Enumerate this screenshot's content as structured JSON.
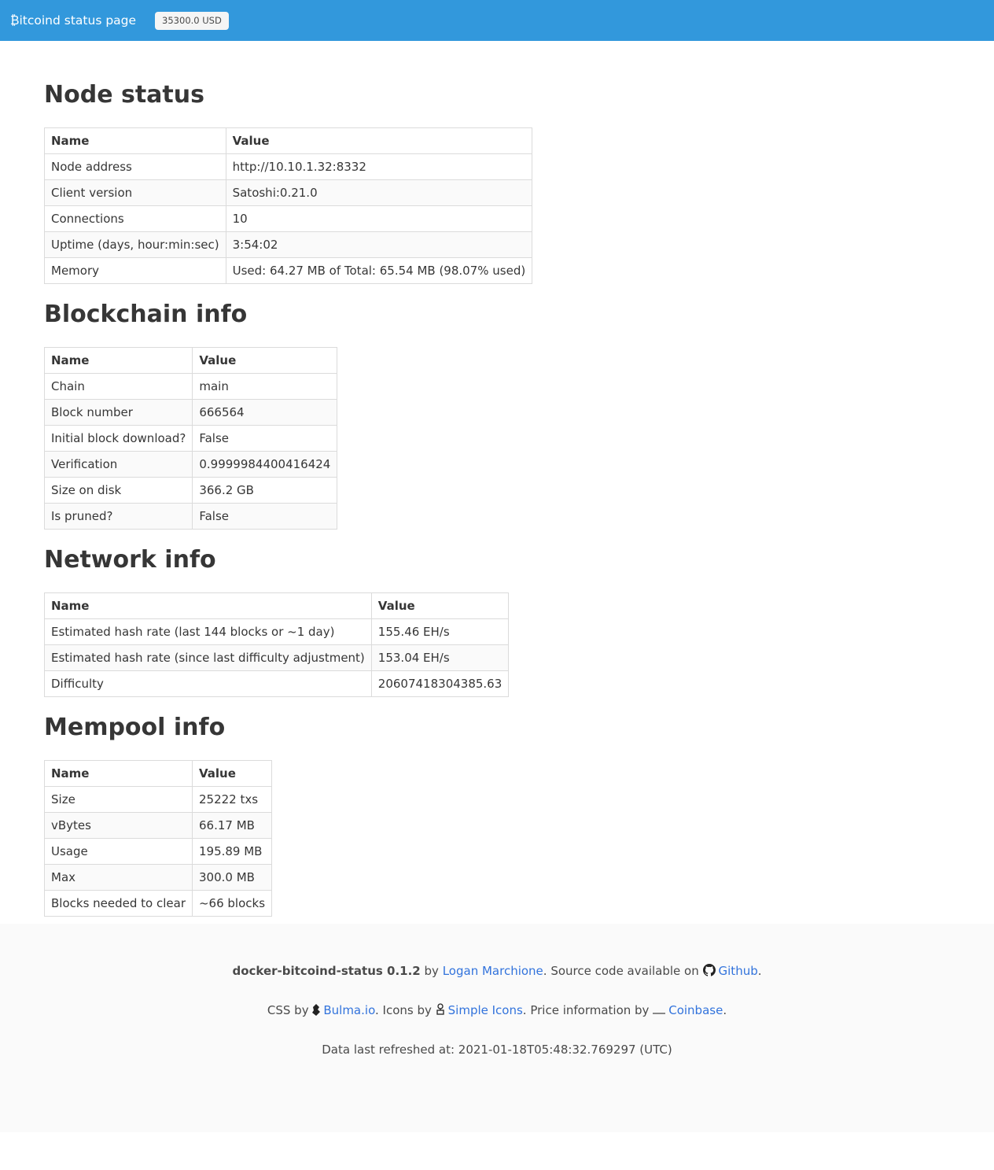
{
  "navbar": {
    "brand_symbol": "₿",
    "brand_label": "itcoind status page",
    "price": "35300.0 USD",
    "color": "#3298dc"
  },
  "sections": {
    "node": {
      "title": "Node status",
      "headers": [
        "Name",
        "Value"
      ],
      "rows": [
        [
          "Node address",
          "http://10.10.1.32:8332"
        ],
        [
          "Client version",
          "Satoshi:0.21.0"
        ],
        [
          "Connections",
          "10"
        ],
        [
          "Uptime (days, hour:min:sec)",
          "3:54:02"
        ],
        [
          "Memory",
          "Used: 64.27 MB of Total: 65.54 MB (98.07% used)"
        ]
      ]
    },
    "blockchain": {
      "title": "Blockchain info",
      "headers": [
        "Name",
        "Value"
      ],
      "rows": [
        [
          "Chain",
          "main"
        ],
        [
          "Block number",
          "666564"
        ],
        [
          "Initial block download?",
          "False"
        ],
        [
          "Verification",
          "0.9999984400416424"
        ],
        [
          "Size on disk",
          "366.2 GB"
        ],
        [
          "Is pruned?",
          "False"
        ]
      ]
    },
    "network": {
      "title": "Network info",
      "headers": [
        "Name",
        "Value"
      ],
      "rows": [
        [
          "Estimated hash rate (last 144 blocks or ~1 day)",
          "155.46 EH/s"
        ],
        [
          "Estimated hash rate (since last difficulty adjustment)",
          "153.04 EH/s"
        ],
        [
          "Difficulty",
          "20607418304385.63"
        ]
      ]
    },
    "mempool": {
      "title": "Mempool info",
      "headers": [
        "Name",
        "Value"
      ],
      "rows": [
        [
          "Size",
          "25222 txs"
        ],
        [
          "vBytes",
          "66.17 MB"
        ],
        [
          "Usage",
          "195.89 MB"
        ],
        [
          "Max",
          "300.0 MB"
        ],
        [
          "Blocks needed to clear",
          "~66 blocks"
        ]
      ]
    }
  },
  "footer": {
    "project": "docker-bitcoind-status 0.1.2",
    "by": "by",
    "author": "Logan Marchione",
    "source_text": ". Source code available on",
    "github": "Github",
    "period": ".",
    "css_by": "CSS by",
    "bulma": "Bulma.io",
    "icons_by": ". Icons by",
    "simple_icons": "Simple Icons",
    "price_by": ". Price information by",
    "coinbase": "Coinbase",
    "refreshed": "Data last refreshed at: 2021-01-18T05:48:32.769297 (UTC)",
    "link_color": "#3273dc"
  }
}
